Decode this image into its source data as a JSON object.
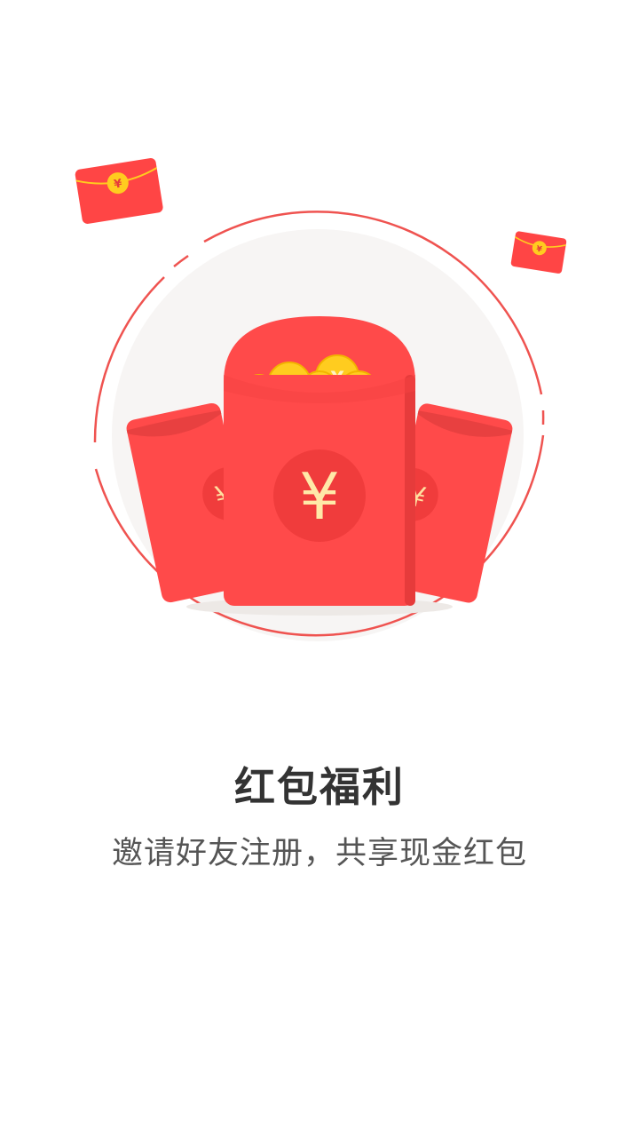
{
  "onboarding": {
    "title": "红包福利",
    "subtitle": "邀请好友注册，共享现金红包"
  },
  "illustration": {
    "currency_symbol": "¥",
    "icons": [
      "red-envelope-icon",
      "gold-coin-icon",
      "yuan-icon"
    ],
    "colors": {
      "envelope_red": "#ff4a4a",
      "envelope_dark": "#e63b3b",
      "seal_red": "#f03c3c",
      "coin_gold": "#ffcc1f",
      "yuan_text": "#ffe9a8",
      "ring_red": "#ef5350",
      "backdrop": "#f7f5f4"
    }
  }
}
